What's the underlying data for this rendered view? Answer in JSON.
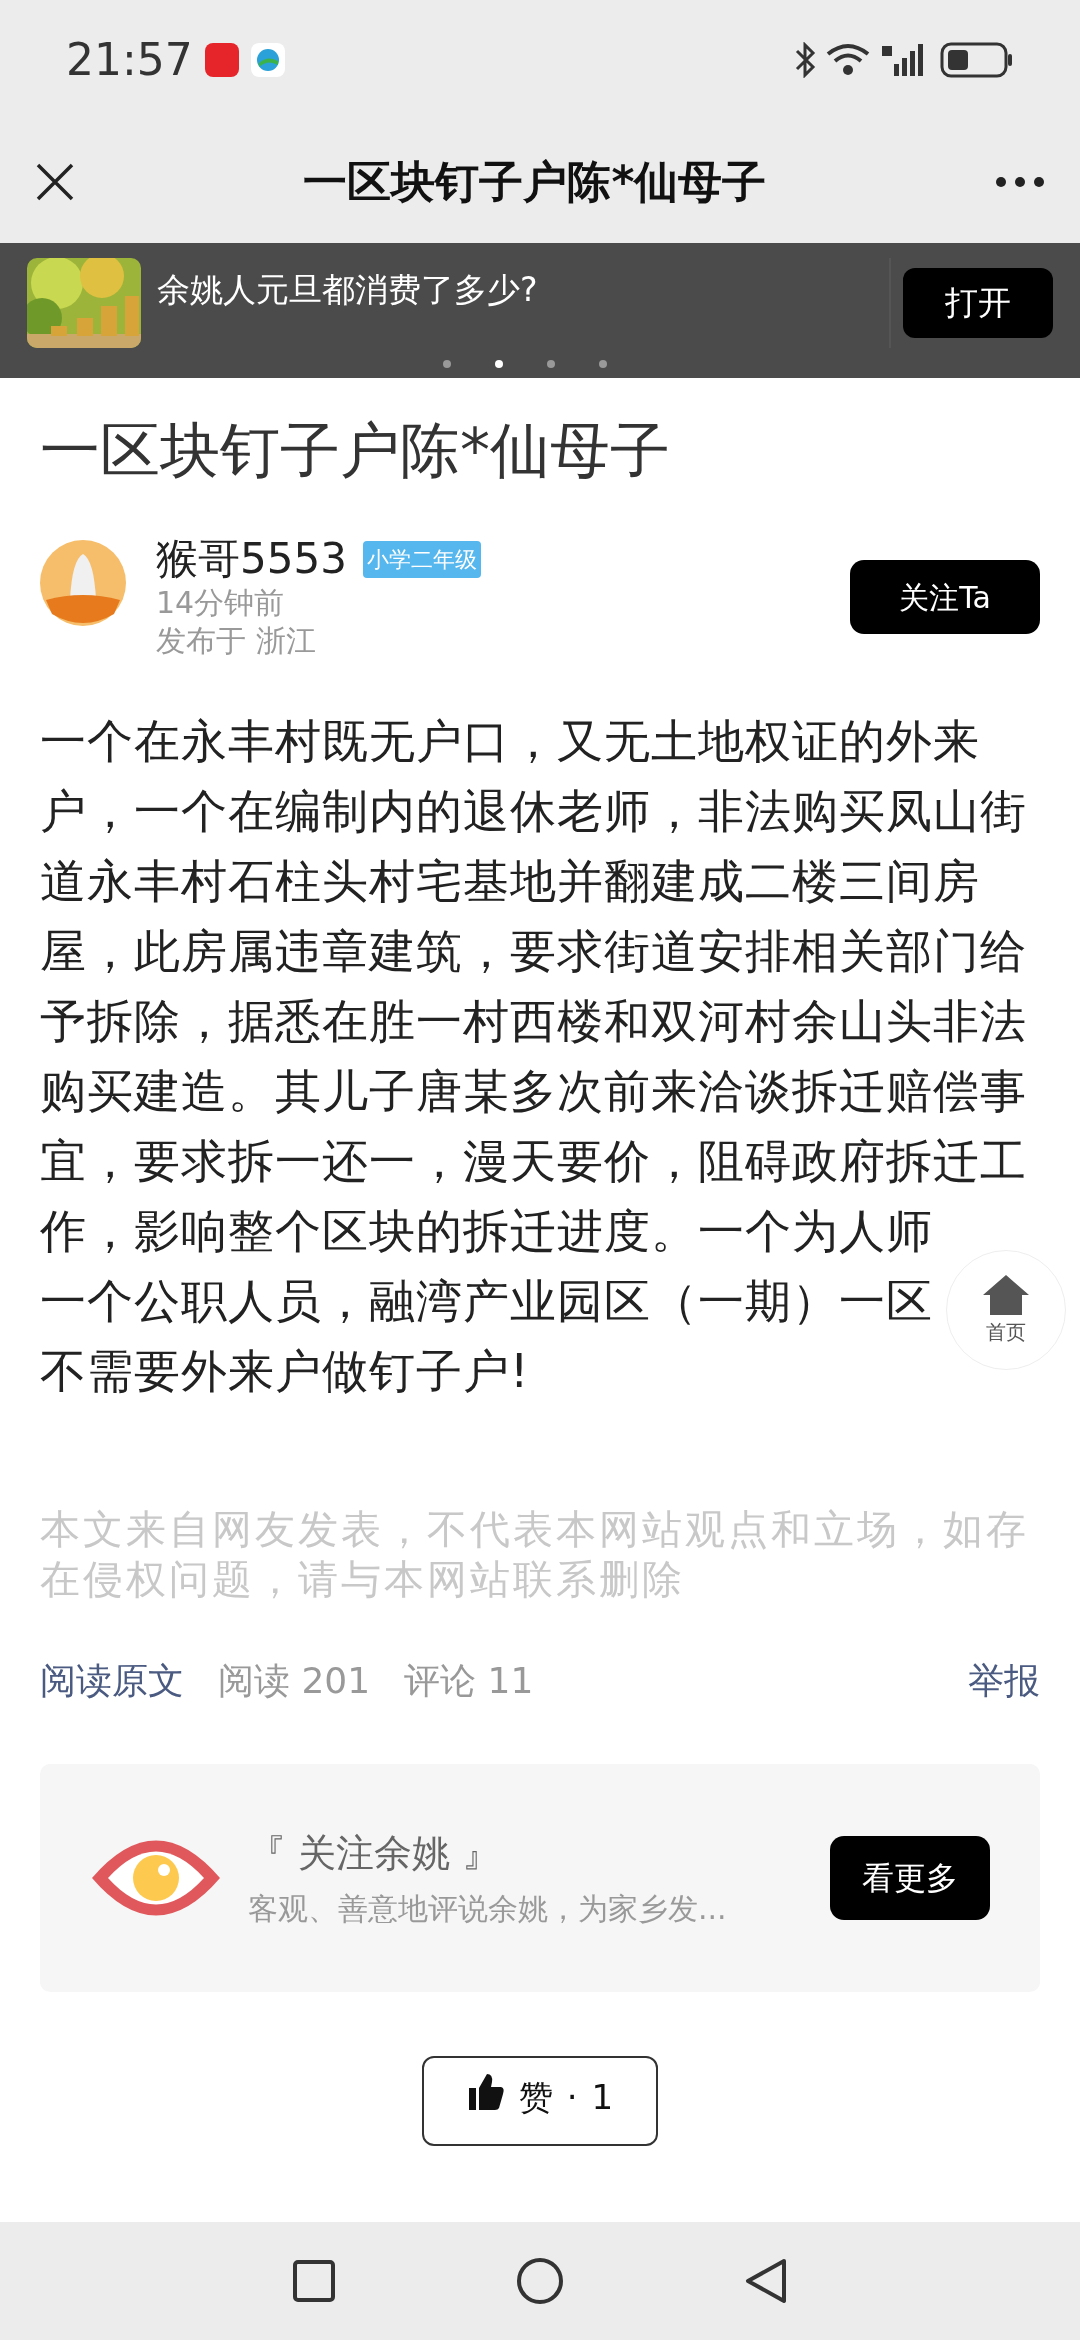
{
  "status_bar": {
    "time": "21:57"
  },
  "nav": {
    "title": "一区块钉子户陈*仙母子"
  },
  "banner": {
    "text": "余姚人元旦都消费了多少?",
    "button": "打开",
    "dots": [
      {
        "selected": false
      },
      {
        "selected": true
      },
      {
        "selected": false
      },
      {
        "selected": false
      }
    ]
  },
  "article": {
    "title": "一区块钉子户陈*仙母子",
    "author": {
      "name": "猴哥5553",
      "badge": "小学二年级",
      "time": "14分钟前",
      "location": "发布于 浙江",
      "follow": "关注Ta"
    },
    "body_lines": [
      "一个在永丰村既无户口，又无土地权证的外来",
      "户，一个在编制内的退休老师，非法购买凤山街",
      "道永丰村石柱头村宅基地并翻建成二楼三间房",
      "屋，此房属违章建筑，要求街道安排相关部门给",
      "予拆除，据悉在胜一村西楼和双河村余山头非法",
      "购买建造。其儿子唐某多次前来洽谈拆迁赔偿事",
      "宜，要求拆一还一，漫天要价，阻碍政府拆迁工",
      "作，影响整个区块的拆迁进度。一个为人师",
      "一个公职人员，融湾产业园区（一期）一区",
      "不需要外来户做钉子户!"
    ],
    "disclaimer": "本文来自网友发表，不代表本网站观点和立场，如存在侵权问题，请与本网站联系删除",
    "read_original": "阅读原文",
    "reads": "阅读 201",
    "comments": "评论 11",
    "report": "举报"
  },
  "promo": {
    "title": "『 关注余姚 』",
    "subtitle": "客观、善意地评说余姚，为家乡发...",
    "button": "看更多"
  },
  "like": {
    "label": "赞",
    "separator": "·",
    "count": "1"
  },
  "home_button": {
    "label": "首页"
  }
}
